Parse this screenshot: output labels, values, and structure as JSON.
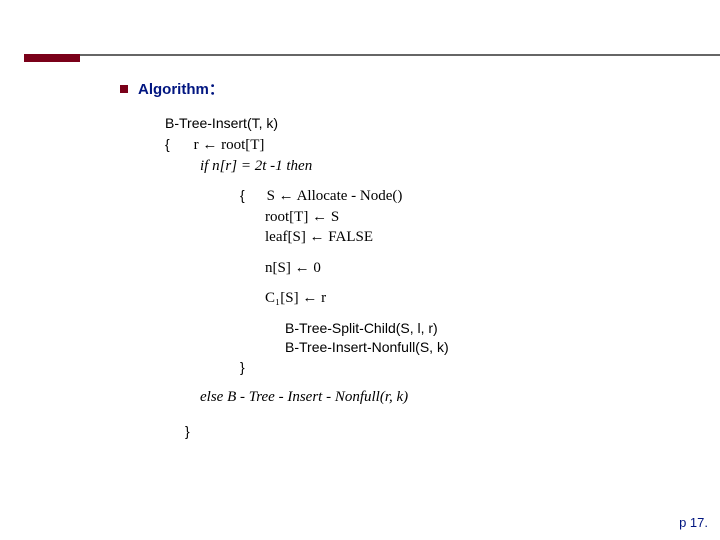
{
  "heading": "Algorithm：",
  "code": {
    "fn_sig": "B-Tree-Insert(T, k)",
    "brace_open": "{",
    "line_r": "r ← root[T]",
    "line_if": "if n[r] = 2t -1 then",
    "line_s_alloc": "S ← Allocate - Node()",
    "line_root_s": "root[T] ← S",
    "line_leaf_s": "leaf[S] ← FALSE",
    "line_ns_0": "n[S] ← 0",
    "line_c1s_r": "C₁[S] ← r",
    "line_split": "B-Tree-Split-Child(S, l, r)",
    "line_insert_nonfull": "B-Tree-Insert-Nonfull(S, k)",
    "brace_close_inner": "}",
    "line_else": "else B - Tree - Insert - Nonfull(r, k)",
    "brace_close_outer": "}"
  },
  "page_label": "p 17."
}
